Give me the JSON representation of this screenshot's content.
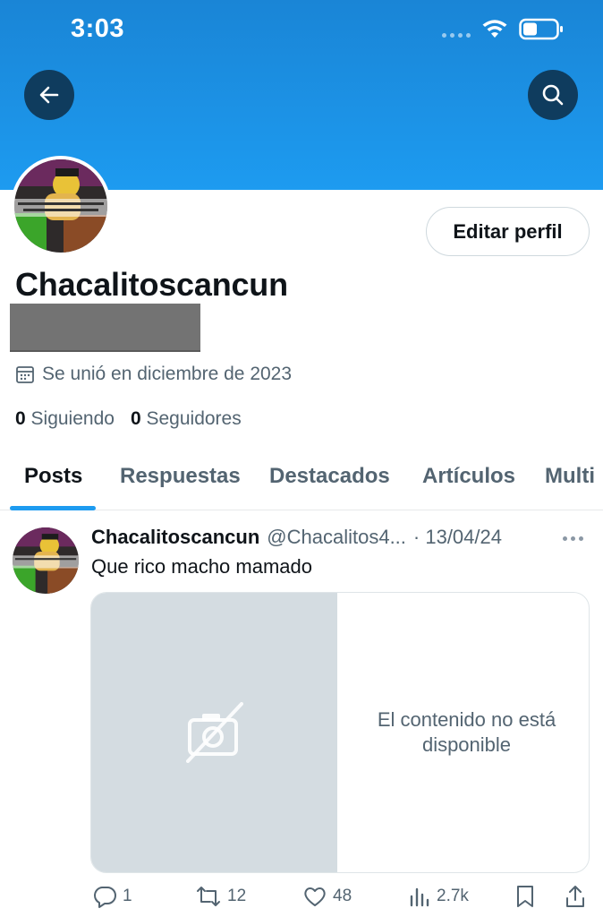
{
  "status_bar": {
    "time": "3:03"
  },
  "header": {
    "back_icon": "arrow-left-icon",
    "search_icon": "search-icon",
    "banner_color": "#1d9bf0"
  },
  "profile": {
    "edit_label": "Editar perfil",
    "display_name": "Chacalitoscancun",
    "joined": "Se unió en diciembre de 2023",
    "following_count": "0",
    "following_label": "Siguiendo",
    "followers_count": "0",
    "followers_label": "Seguidores"
  },
  "tabs": [
    "Posts",
    "Respuestas",
    "Destacados",
    "Artículos",
    "Multi"
  ],
  "active_tab": "Posts",
  "post": {
    "author": "Chacalitoscancun",
    "handle": "@Chacalitos4...",
    "date": "· 13/04/24",
    "text": "Que rico macho mamado",
    "unavailable": "El contenido no está disponible",
    "actions": {
      "replies": "1",
      "reposts": "12",
      "likes": "48",
      "views": "2.7k"
    }
  },
  "colors": {
    "accent": "#1d9bf0",
    "text": "#0f1419",
    "muted": "#536471"
  }
}
